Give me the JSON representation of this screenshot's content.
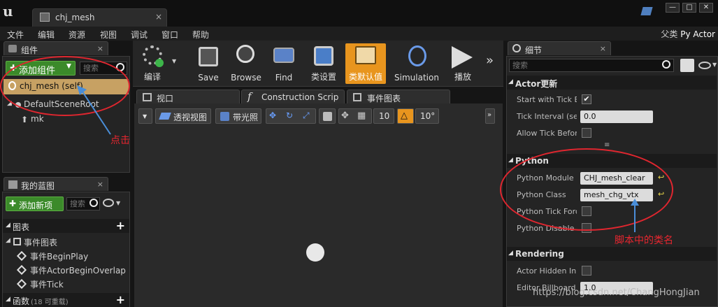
{
  "window": {
    "doc_tab": "chj_mesh",
    "parent_label": "父类",
    "parent_value": "Py Actor"
  },
  "menu": [
    "文件",
    "编辑",
    "资源",
    "视图",
    "调试",
    "窗口",
    "帮助"
  ],
  "components": {
    "tab": "组件",
    "add_button": "添加组件",
    "search_placeholder": "搜索",
    "items": [
      "chj_mesh (self)",
      "DefaultSceneRoot",
      "mk"
    ]
  },
  "my_blueprint": {
    "tab": "我的蓝图",
    "add_button": "添加新项",
    "search_placeholder": "搜索",
    "graphs_header": "图表",
    "event_graph": "事件图表",
    "events": [
      "事件BeginPlay",
      "事件ActorBeginOverlap",
      "事件Tick"
    ],
    "functions_header": "函数",
    "functions_count": "(18 可重载)"
  },
  "toolbar": [
    "编译",
    "Save",
    "Browse",
    "Find",
    "类设置",
    "类默认值",
    "Simulation",
    "播放"
  ],
  "viewport_tabs": [
    "视口",
    "Construction Scrip",
    "事件图表"
  ],
  "viewport_buttons": {
    "perspective": "透视视图",
    "lit": "带光照",
    "grid": "10",
    "angle": "10°"
  },
  "details": {
    "tab": "细节",
    "search_placeholder": "搜索",
    "actor_section": "Actor更新",
    "actor_props": [
      {
        "label": "Start with Tick Er",
        "value": "checked"
      },
      {
        "label": "Tick Interval (sec",
        "value": "0.0"
      },
      {
        "label": "Allow Tick Before",
        "value": "unchecked"
      }
    ],
    "python_section": "Python",
    "python_props": [
      {
        "label": "Python Module",
        "value": "CHJ_mesh_clear"
      },
      {
        "label": "Python Class",
        "value": "mesh_chg_vtx"
      },
      {
        "label": "Python Tick Force",
        "value": "unchecked"
      },
      {
        "label": "Python Disable Au",
        "value": "unchecked"
      }
    ],
    "rendering_section": "Rendering",
    "rendering_props": [
      {
        "label": "Actor Hidden In G",
        "value": "unchecked"
      },
      {
        "label": "Editor Billboard S",
        "value": "1.0"
      }
    ]
  },
  "annotations": {
    "click": "点击",
    "class_name": "脚本中的类名"
  },
  "watermark": "https://blog.csdn.net/ChangHongJian"
}
